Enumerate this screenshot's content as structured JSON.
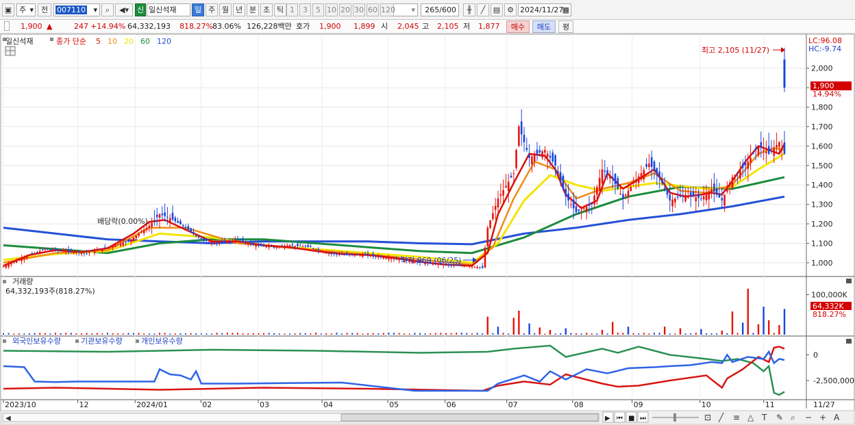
{
  "toolbar": {
    "market": "주",
    "prefix": "전",
    "code": "007110",
    "sin_badge": "신",
    "name": "일신석재",
    "periods": [
      "일",
      "주",
      "월",
      "년",
      "분",
      "초",
      "틱"
    ],
    "active_period": "일",
    "intervals": [
      "1",
      "3",
      "5",
      "10",
      "20",
      "30",
      "60",
      "120"
    ],
    "count": "265",
    "count_total": "/600",
    "date": "2024/11/27"
  },
  "quote": {
    "price": "1,900",
    "change": "247",
    "change_pct": "+14.94%",
    "volume": "64,332,193",
    "volume_ratio": "818.27%",
    "turnover_ratio": "83.06%",
    "amount": "126,228백만",
    "bid_label": "호가",
    "ask": "1,900",
    "bid": "1,899",
    "open_label": "시",
    "open": "2,045",
    "high_label": "고",
    "high": "2,105",
    "low_label": "저",
    "low": "1,877",
    "buy_label": "매수",
    "sell_label": "매도",
    "eval_label": "평"
  },
  "colors": {
    "up": "#e8120c",
    "down": "#1747e0",
    "ma5": "#d8100a",
    "ma10": "#f08c14",
    "ma20": "#f2e500",
    "ma60": "#1a8c3c",
    "ma120": "#2350d6",
    "foreign": "#2d64e6",
    "inst": "#d81414",
    "indiv": "#2a9052"
  },
  "chart_data": [
    {
      "type": "candlestick",
      "title": "일신석재",
      "legend": {
        "label": "종가 단순",
        "periods": [
          "5",
          "10",
          "20",
          "60",
          "120"
        ]
      },
      "x_labels": [
        "2023/10",
        "12",
        "2024/01",
        "02",
        "03",
        "04",
        "05",
        "06",
        "07",
        "08",
        "09",
        "10",
        "11",
        "11/27"
      ],
      "y_ticks": [
        "2,000",
        "1,900",
        "1,800",
        "1,700",
        "1,600",
        "1,500",
        "1,400",
        "1,300",
        "1,200",
        "1,100",
        "1,000"
      ],
      "ylim": [
        940,
        2150
      ],
      "lc": "LC:96.08",
      "hc": "HC:-9.74",
      "last_price": "1,900",
      "last_pct": "14.94%",
      "annotations": {
        "high": "최고 2,105 (11/27)",
        "low": "최저 969 (06/25)",
        "dividend": "배당락(0.00%)"
      },
      "price_path": [
        [
          0,
          980
        ],
        [
          8,
          1030
        ],
        [
          16,
          1070
        ],
        [
          24,
          1060
        ],
        [
          32,
          1050
        ],
        [
          40,
          1080
        ],
        [
          48,
          1110
        ],
        [
          56,
          1190
        ],
        [
          60,
          1250
        ],
        [
          64,
          1230
        ],
        [
          70,
          1180
        ],
        [
          76,
          1120
        ],
        [
          82,
          1100
        ],
        [
          90,
          1120
        ],
        [
          96,
          1090
        ],
        [
          104,
          1080
        ],
        [
          110,
          1090
        ],
        [
          118,
          1080
        ],
        [
          124,
          1050
        ],
        [
          132,
          1040
        ],
        [
          140,
          1040
        ],
        [
          150,
          1020
        ],
        [
          160,
          1000
        ],
        [
          170,
          990
        ],
        [
          178,
          985
        ],
        [
          184,
          975
        ],
        [
          186,
          1180
        ],
        [
          190,
          1330
        ],
        [
          196,
          1460
        ],
        [
          198,
          1700
        ],
        [
          202,
          1540
        ],
        [
          208,
          1580
        ],
        [
          212,
          1500
        ],
        [
          216,
          1340
        ],
        [
          220,
          1260
        ],
        [
          226,
          1300
        ],
        [
          230,
          1480
        ],
        [
          234,
          1430
        ],
        [
          238,
          1330
        ],
        [
          242,
          1410
        ],
        [
          248,
          1510
        ],
        [
          252,
          1440
        ],
        [
          256,
          1320
        ],
        [
          262,
          1350
        ],
        [
          268,
          1330
        ],
        [
          272,
          1380
        ],
        [
          276,
          1320
        ],
        [
          280,
          1440
        ],
        [
          285,
          1500
        ],
        [
          290,
          1600
        ],
        [
          294,
          1560
        ],
        [
          298,
          1620
        ],
        [
          300,
          1560
        ]
      ],
      "ma5_points": [
        [
          0,
          985
        ],
        [
          10,
          1040
        ],
        [
          20,
          1065
        ],
        [
          30,
          1055
        ],
        [
          40,
          1075
        ],
        [
          50,
          1150
        ],
        [
          56,
          1210
        ],
        [
          62,
          1220
        ],
        [
          70,
          1170
        ],
        [
          80,
          1110
        ],
        [
          90,
          1110
        ],
        [
          100,
          1090
        ],
        [
          110,
          1080
        ],
        [
          120,
          1060
        ],
        [
          130,
          1045
        ],
        [
          140,
          1040
        ],
        [
          150,
          1025
        ],
        [
          160,
          1005
        ],
        [
          170,
          990
        ],
        [
          180,
          985
        ],
        [
          186,
          1050
        ],
        [
          190,
          1250
        ],
        [
          196,
          1410
        ],
        [
          202,
          1560
        ],
        [
          208,
          1550
        ],
        [
          212,
          1480
        ],
        [
          216,
          1350
        ],
        [
          222,
          1280
        ],
        [
          228,
          1320
        ],
        [
          232,
          1460
        ],
        [
          238,
          1380
        ],
        [
          244,
          1430
        ],
        [
          250,
          1480
        ],
        [
          256,
          1360
        ],
        [
          262,
          1340
        ],
        [
          268,
          1350
        ],
        [
          272,
          1360
        ],
        [
          276,
          1350
        ],
        [
          280,
          1420
        ],
        [
          285,
          1520
        ],
        [
          290,
          1600
        ],
        [
          294,
          1580
        ],
        [
          298,
          1560
        ],
        [
          300,
          1610
        ]
      ],
      "ma10_points": [
        [
          0,
          1000
        ],
        [
          20,
          1050
        ],
        [
          40,
          1065
        ],
        [
          56,
          1180
        ],
        [
          70,
          1180
        ],
        [
          90,
          1100
        ],
        [
          120,
          1065
        ],
        [
          150,
          1030
        ],
        [
          180,
          990
        ],
        [
          188,
          1080
        ],
        [
          196,
          1330
        ],
        [
          204,
          1520
        ],
        [
          212,
          1480
        ],
        [
          220,
          1330
        ],
        [
          230,
          1380
        ],
        [
          240,
          1410
        ],
        [
          250,
          1460
        ],
        [
          260,
          1370
        ],
        [
          270,
          1360
        ],
        [
          280,
          1400
        ],
        [
          290,
          1560
        ],
        [
          296,
          1590
        ],
        [
          300,
          1580
        ]
      ],
      "ma20_points": [
        [
          0,
          1015
        ],
        [
          20,
          1045
        ],
        [
          40,
          1060
        ],
        [
          60,
          1150
        ],
        [
          80,
          1130
        ],
        [
          100,
          1090
        ],
        [
          130,
          1060
        ],
        [
          160,
          1030
        ],
        [
          180,
          1000
        ],
        [
          190,
          1100
        ],
        [
          200,
          1320
        ],
        [
          210,
          1450
        ],
        [
          220,
          1400
        ],
        [
          230,
          1370
        ],
        [
          250,
          1410
        ],
        [
          270,
          1380
        ],
        [
          280,
          1390
        ],
        [
          290,
          1480
        ],
        [
          300,
          1560
        ]
      ],
      "ma60_points": [
        [
          0,
          1090
        ],
        [
          20,
          1070
        ],
        [
          40,
          1050
        ],
        [
          60,
          1100
        ],
        [
          80,
          1120
        ],
        [
          100,
          1120
        ],
        [
          120,
          1100
        ],
        [
          140,
          1080
        ],
        [
          160,
          1060
        ],
        [
          180,
          1050
        ],
        [
          200,
          1130
        ],
        [
          220,
          1250
        ],
        [
          240,
          1340
        ],
        [
          260,
          1390
        ],
        [
          280,
          1380
        ],
        [
          290,
          1410
        ],
        [
          300,
          1440
        ]
      ],
      "ma120_points": [
        [
          0,
          1180
        ],
        [
          20,
          1150
        ],
        [
          40,
          1120
        ],
        [
          60,
          1110
        ],
        [
          80,
          1100
        ],
        [
          100,
          1110
        ],
        [
          120,
          1110
        ],
        [
          140,
          1110
        ],
        [
          160,
          1100
        ],
        [
          180,
          1095
        ],
        [
          200,
          1150
        ],
        [
          220,
          1180
        ],
        [
          240,
          1220
        ],
        [
          260,
          1250
        ],
        [
          280,
          1290
        ],
        [
          300,
          1340
        ]
      ]
    },
    {
      "type": "bar",
      "title": "거래량",
      "subtitle": "64,332,193주(818.27%)",
      "y_ticks": [
        "100,000K"
      ],
      "ylim": [
        0,
        130000
      ],
      "last_value": "64,332K",
      "last_pct": "818.27%",
      "volume_spikes": [
        [
          186,
          45000
        ],
        [
          190,
          20000
        ],
        [
          196,
          42000
        ],
        [
          198,
          60000
        ],
        [
          202,
          28000
        ],
        [
          206,
          18000
        ],
        [
          210,
          12000
        ],
        [
          216,
          16000
        ],
        [
          230,
          12000
        ],
        [
          234,
          32000
        ],
        [
          240,
          20000
        ],
        [
          254,
          20000
        ],
        [
          260,
          16000
        ],
        [
          268,
          14000
        ],
        [
          276,
          10000
        ],
        [
          280,
          58000
        ],
        [
          284,
          30000
        ],
        [
          286,
          115000
        ],
        [
          290,
          26000
        ],
        [
          292,
          70000
        ],
        [
          294,
          36000
        ],
        [
          298,
          24000
        ],
        [
          300,
          64332
        ]
      ]
    },
    {
      "type": "line",
      "title": "외국인보유수량",
      "series": [
        {
          "name": "외국인보유수량"
        },
        {
          "name": "기관보유수량"
        },
        {
          "name": "개인보유수량"
        }
      ],
      "y_ticks": [
        "0",
        "-2,500,000"
      ],
      "ylim": [
        -4300000,
        1300000
      ],
      "foreign_points": [
        [
          0,
          -1100000
        ],
        [
          8,
          -1200000
        ],
        [
          12,
          -2600000
        ],
        [
          20,
          -2650000
        ],
        [
          28,
          -2600000
        ],
        [
          58,
          -2600000
        ],
        [
          60,
          -1400000
        ],
        [
          64,
          -1900000
        ],
        [
          68,
          -2000000
        ],
        [
          72,
          -2400000
        ],
        [
          74,
          -1600000
        ],
        [
          76,
          -2800000
        ],
        [
          90,
          -2800000
        ],
        [
          130,
          -2700000
        ],
        [
          158,
          -3500000
        ],
        [
          186,
          -3500000
        ],
        [
          190,
          -2800000
        ],
        [
          200,
          -2000000
        ],
        [
          206,
          -2600000
        ],
        [
          210,
          -1600000
        ],
        [
          216,
          -2400000
        ],
        [
          224,
          -1400000
        ],
        [
          232,
          -1800000
        ],
        [
          240,
          -1300000
        ],
        [
          250,
          -1200000
        ],
        [
          256,
          -1100000
        ],
        [
          264,
          -1000000
        ],
        [
          272,
          -700000
        ],
        [
          276,
          -800000
        ],
        [
          278,
          0
        ],
        [
          280,
          -700000
        ],
        [
          286,
          -200000
        ],
        [
          292,
          -400000
        ],
        [
          294,
          300000
        ],
        [
          296,
          -800000
        ],
        [
          298,
          -400000
        ],
        [
          300,
          -500000
        ]
      ],
      "inst_points": [
        [
          0,
          -3300000
        ],
        [
          20,
          -3200000
        ],
        [
          60,
          -3400000
        ],
        [
          100,
          -3200000
        ],
        [
          140,
          -3300000
        ],
        [
          184,
          -3500000
        ],
        [
          190,
          -3000000
        ],
        [
          200,
          -2600000
        ],
        [
          210,
          -2900000
        ],
        [
          216,
          -1900000
        ],
        [
          230,
          -2800000
        ],
        [
          236,
          -3100000
        ],
        [
          244,
          -3000000
        ],
        [
          256,
          -2500000
        ],
        [
          270,
          -2000000
        ],
        [
          276,
          -3200000
        ],
        [
          278,
          -2300000
        ],
        [
          284,
          -1400000
        ],
        [
          290,
          -200000
        ],
        [
          294,
          -700000
        ],
        [
          296,
          700000
        ],
        [
          298,
          800000
        ],
        [
          300,
          600000
        ]
      ],
      "indiv_points": [
        [
          0,
          400000
        ],
        [
          40,
          300000
        ],
        [
          80,
          500000
        ],
        [
          120,
          400000
        ],
        [
          160,
          200000
        ],
        [
          186,
          300000
        ],
        [
          196,
          600000
        ],
        [
          210,
          900000
        ],
        [
          216,
          -200000
        ],
        [
          230,
          600000
        ],
        [
          236,
          200000
        ],
        [
          244,
          800000
        ],
        [
          250,
          400000
        ],
        [
          256,
          0
        ],
        [
          270,
          -400000
        ],
        [
          276,
          -600000
        ],
        [
          282,
          -400000
        ],
        [
          288,
          -800000
        ],
        [
          292,
          -1600000
        ],
        [
          294,
          -1100000
        ],
        [
          296,
          -3700000
        ],
        [
          298,
          -3900000
        ],
        [
          300,
          -3600000
        ]
      ]
    }
  ],
  "status": {
    "date_label": "11/27"
  }
}
